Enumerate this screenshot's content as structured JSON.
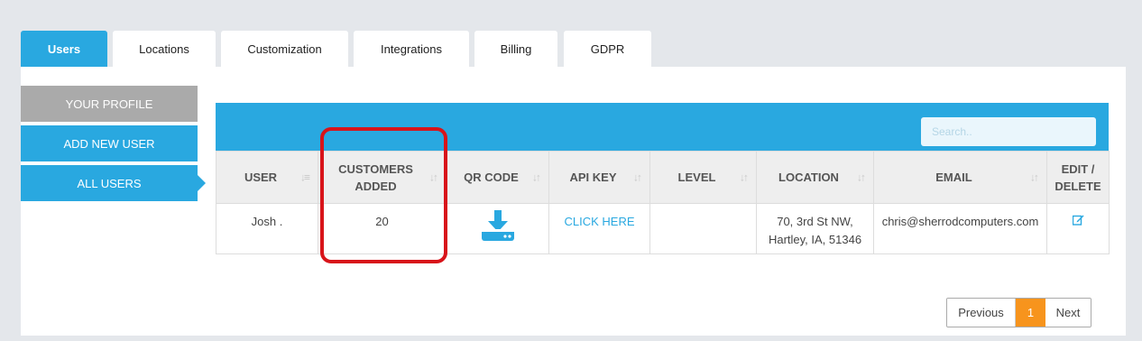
{
  "tabs": [
    {
      "label": "Users"
    },
    {
      "label": "Locations"
    },
    {
      "label": "Customization"
    },
    {
      "label": "Integrations"
    },
    {
      "label": "Billing"
    },
    {
      "label": "GDPR"
    }
  ],
  "sidebar": {
    "profile": "YOUR PROFILE",
    "add_user": "ADD NEW USER",
    "all_users": "ALL USERS"
  },
  "search": {
    "placeholder": "Search.."
  },
  "table": {
    "headers": {
      "user": "USER",
      "customers_added": "CUSTOMERS ADDED",
      "qr_code": "QR CODE",
      "api_key": "API KEY",
      "level": "LEVEL",
      "location": "LOCATION",
      "email": "EMAIL",
      "edit_delete": "EDIT / DELETE"
    },
    "rows": [
      {
        "user": "Josh .",
        "customers_added": "20",
        "qr_code": "download-icon",
        "api_key": "CLICK HERE",
        "level": "",
        "location_line1": "70, 3rd St NW,",
        "location_line2": "Hartley, IA, 51346",
        "email": "chris@sherrodcomputers.com",
        "edit": "edit-icon"
      }
    ]
  },
  "pagination": {
    "previous": "Previous",
    "current": "1",
    "next": "Next"
  },
  "colors": {
    "accent": "#29a8e0",
    "page_active": "#f7941d",
    "highlight": "#d8141a",
    "inactive_sidebar": "#aaaaaa"
  }
}
